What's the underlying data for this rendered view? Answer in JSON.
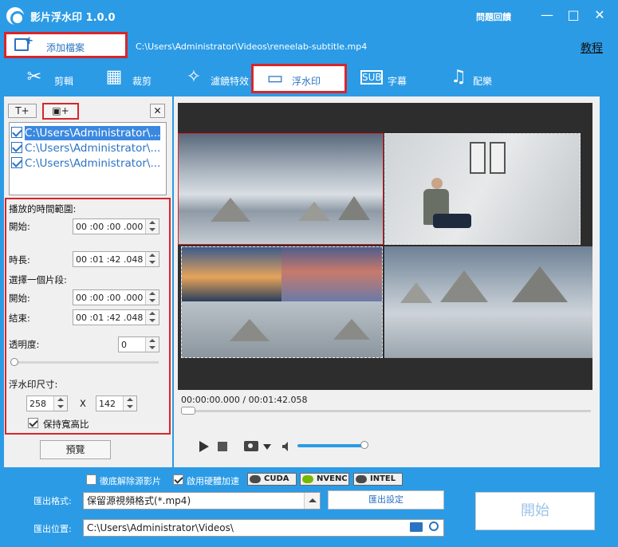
{
  "app": {
    "title": "影片浮水印 1.0.0",
    "help_label": "問題回饋",
    "window_controls": {
      "minimize": "—",
      "maximize": "□",
      "close": "✕"
    }
  },
  "toolbar": {
    "add_file_label": "添加檔案",
    "file_path": "C:\\Users\\Administrator\\Videos\\reneelab-subtitle.mp4",
    "tutorial_label": "教程"
  },
  "tabs": [
    {
      "label": "剪輯",
      "icon": "scissors-film-icon"
    },
    {
      "label": "裁剪",
      "icon": "crop-film-icon"
    },
    {
      "label": "濾鏡特效",
      "icon": "magic-wand-icon"
    },
    {
      "label": "浮水印",
      "icon": "watermark-icon",
      "active": true
    },
    {
      "label": "字幕",
      "icon": "subtitle-icon"
    },
    {
      "label": "配樂",
      "icon": "music-note-icon"
    }
  ],
  "watermark_panel": {
    "add_text_label": "T+",
    "add_image_label": "▣+",
    "remove_label": "✕",
    "items": [
      {
        "path": "C:\\Users\\Administrator\\...",
        "checked": true,
        "selected": true
      },
      {
        "path": "C:\\Users\\Administrator\\...",
        "checked": true,
        "selected": false
      },
      {
        "path": "C:\\Users\\Administrator\\...",
        "checked": true,
        "selected": false
      }
    ],
    "play_range_label": "播放的時間範圍:",
    "start_label": "開始:",
    "start_value": "00 :00 :00 .000",
    "duration_label": "時長:",
    "duration_value": "00 :01 :42 .048",
    "segment_label": "選擇一個片段:",
    "seg_start_label": "開始:",
    "seg_start_value": "00 :00 :00 .000",
    "seg_end_label": "結束:",
    "seg_end_value": "00 :01 :42 .048",
    "opacity_label": "透明度:",
    "opacity_value": "0",
    "size_label": "浮水印尺寸:",
    "width_value": "258",
    "x_sep": "X",
    "height_value": "142",
    "keep_ratio_label": "保持寬高比",
    "keep_ratio_checked": true,
    "preview_label": "預覽"
  },
  "player": {
    "time_readout": "00:00:00.000 / 00:01:42.058",
    "volume_level": 0.9
  },
  "bottom": {
    "deinterlace_label": "徹底解除源影片",
    "hw_accel_label": "啟用硬體加速",
    "gpu_badges": [
      "CUDA",
      "NVENC",
      "INTEL"
    ],
    "format_label": "匯出格式:",
    "format_value": "保留源視頻格式(*.mp4)",
    "export_settings_label": "匯出設定",
    "location_label": "匯出位置:",
    "location_value": "C:\\Users\\Administrator\\Videos\\",
    "start_label": "開始"
  },
  "colors": {
    "brand_blue": "#2b9be6",
    "highlight_red": "#d9252a",
    "link_blue": "#2b73c2"
  }
}
